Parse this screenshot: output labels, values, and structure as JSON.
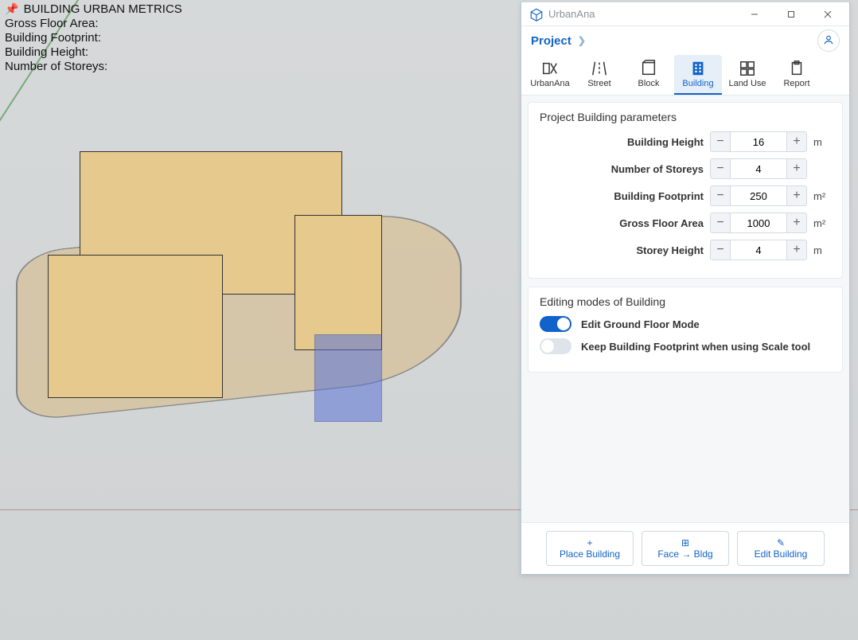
{
  "viewport_overlay": {
    "title": "BUILDING URBAN METRICS",
    "lines": [
      "Gross Floor Area:",
      "Building Footprint:",
      "Building Height:",
      "Number of Storeys:"
    ]
  },
  "window": {
    "app_name": "UrbanAna",
    "breadcrumb": "Project"
  },
  "tabs": [
    {
      "id": "urbanana",
      "label": "UrbanAna"
    },
    {
      "id": "street",
      "label": "Street"
    },
    {
      "id": "block",
      "label": "Block"
    },
    {
      "id": "building",
      "label": "Building"
    },
    {
      "id": "landuse",
      "label": "Land Use"
    },
    {
      "id": "report",
      "label": "Report"
    }
  ],
  "active_tab": "building",
  "params_card": {
    "title": "Project Building parameters",
    "rows": [
      {
        "key": "building_height",
        "label": "Building Height",
        "value": "16",
        "unit": "m"
      },
      {
        "key": "number_of_storeys",
        "label": "Number of Storeys",
        "value": "4",
        "unit": ""
      },
      {
        "key": "building_footprint",
        "label": "Building Footprint",
        "value": "250",
        "unit": "m²"
      },
      {
        "key": "gross_floor_area",
        "label": "Gross Floor Area",
        "value": "1000",
        "unit": "m²"
      },
      {
        "key": "storey_height",
        "label": "Storey Height",
        "value": "4",
        "unit": "m"
      }
    ]
  },
  "modes_card": {
    "title": "Editing modes of Building",
    "toggles": [
      {
        "key": "edit_ground_floor",
        "label": "Edit Ground Floor Mode",
        "on": true
      },
      {
        "key": "keep_footprint",
        "label": "Keep Building Footprint when using Scale tool",
        "on": false
      }
    ]
  },
  "actions": [
    {
      "key": "place",
      "label": "Place Building",
      "icon": "+"
    },
    {
      "key": "face",
      "label": "Face → Bldg",
      "icon": "⊞"
    },
    {
      "key": "edit",
      "label": "Edit Building",
      "icon": "✎"
    }
  ]
}
